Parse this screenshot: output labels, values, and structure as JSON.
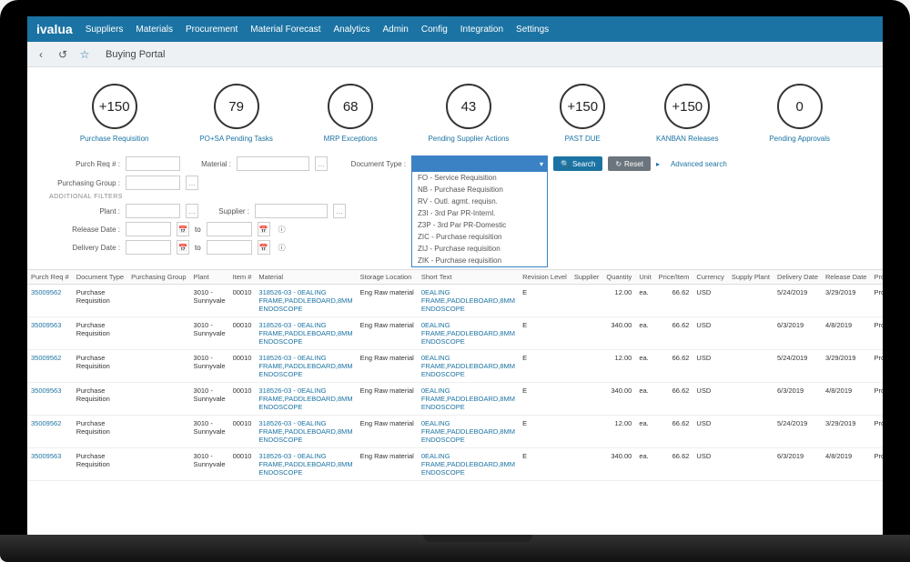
{
  "brand": "ivalua",
  "nav": [
    "Suppliers",
    "Materials",
    "Procurement",
    "Material Forecast",
    "Analytics",
    "Admin",
    "Config",
    "Integration",
    "Settings"
  ],
  "page_title": "Buying Portal",
  "kpis": [
    {
      "value": "+150",
      "label": "Purchase Requisition"
    },
    {
      "value": "79",
      "label": "PO+SA Pending Tasks"
    },
    {
      "value": "68",
      "label": "MRP Exceptions"
    },
    {
      "value": "43",
      "label": "Pending Supplier Actions"
    },
    {
      "value": "+150",
      "label": "PAST DUE"
    },
    {
      "value": "+150",
      "label": "KANBAN Releases"
    },
    {
      "value": "0",
      "label": "Pending Approvals"
    }
  ],
  "filters": {
    "purch_req_label": "Purch Req # :",
    "material_label": "Material :",
    "document_type_label": "Document Type :",
    "purchasing_group_label": "Purchasing Group :",
    "additional_filters_label": "ADDITIONAL FILTERS",
    "plant_label": "Plant :",
    "supplier_label": "Supplier :",
    "release_date_label": "Release Date :",
    "delivery_date_label": "Delivery Date :",
    "to_label": "to",
    "search_btn": "Search",
    "reset_btn": "Reset",
    "advanced_link": "Advanced search",
    "doc_type_options": [
      "FO - Service Requisition",
      "NB - Purchase Requisition",
      "RV - Outl. agmt. requisn.",
      "Z3I - 3rd Par PR-Internl.",
      "Z3P - 3rd Par PR-Domestic",
      "ZIC - Purchase requisition",
      "ZIJ - Purchase requisition",
      "ZIK - Purchase requisition"
    ]
  },
  "table": {
    "headers": [
      "Purch Req #",
      "Document Type",
      "Purchasing Group",
      "Plant",
      "Item #",
      "Material",
      "Storage Location",
      "Short Text",
      "Revision Level",
      "Supplier",
      "Quantity",
      "Unit",
      "Price/Item",
      "Currency",
      "Supply Plant",
      "Delivery Date",
      "Release Date",
      "Products types"
    ],
    "rows": [
      {
        "req": "35009562",
        "doc": "Purchase Requisition",
        "pg": "",
        "plant": "3010 - Sunnyvale",
        "item": "00010",
        "mat": "318526-03 - 0EALING FRAME,PADDLEBOARD,8MM ENDOSCOPE",
        "stor": "Eng Raw material",
        "short": "0EALING FRAME,PADDLEBOARD,8MM ENDOSCOPE",
        "rev": "E",
        "sup": "",
        "qty": "12.00",
        "unit": "ea.",
        "price": "66.62",
        "curr": "USD",
        "splant": "",
        "ddate": "5/24/2019",
        "rdate": "3/29/2019",
        "ptype": "Product"
      },
      {
        "req": "35009563",
        "doc": "Purchase Requisition",
        "pg": "",
        "plant": "3010 - Sunnyvale",
        "item": "00010",
        "mat": "318526-03 - 0EALING FRAME,PADDLEBOARD,8MM ENDOSCOPE",
        "stor": "Eng Raw material",
        "short": "0EALING FRAME,PADDLEBOARD,8MM ENDOSCOPE",
        "rev": "E",
        "sup": "",
        "qty": "340.00",
        "unit": "ea.",
        "price": "66.62",
        "curr": "USD",
        "splant": "",
        "ddate": "6/3/2019",
        "rdate": "4/8/2019",
        "ptype": "Product"
      },
      {
        "req": "35009562",
        "doc": "Purchase Requisition",
        "pg": "",
        "plant": "3010 - Sunnyvale",
        "item": "00010",
        "mat": "318526-03 - 0EALING FRAME,PADDLEBOARD,8MM ENDOSCOPE",
        "stor": "Eng Raw material",
        "short": "0EALING FRAME,PADDLEBOARD,8MM ENDOSCOPE",
        "rev": "E",
        "sup": "",
        "qty": "12.00",
        "unit": "ea.",
        "price": "66.62",
        "curr": "USD",
        "splant": "",
        "ddate": "5/24/2019",
        "rdate": "3/29/2019",
        "ptype": "Product"
      },
      {
        "req": "35009563",
        "doc": "Purchase Requisition",
        "pg": "",
        "plant": "3010 - Sunnyvale",
        "item": "00010",
        "mat": "318526-03 - 0EALING FRAME,PADDLEBOARD,8MM ENDOSCOPE",
        "stor": "Eng Raw material",
        "short": "0EALING FRAME,PADDLEBOARD,8MM ENDOSCOPE",
        "rev": "E",
        "sup": "",
        "qty": "340.00",
        "unit": "ea.",
        "price": "66.62",
        "curr": "USD",
        "splant": "",
        "ddate": "6/3/2019",
        "rdate": "4/8/2019",
        "ptype": "Product"
      },
      {
        "req": "35009562",
        "doc": "Purchase Requisition",
        "pg": "",
        "plant": "3010 - Sunnyvale",
        "item": "00010",
        "mat": "318526-03 - 0EALING FRAME,PADDLEBOARD,8MM ENDOSCOPE",
        "stor": "Eng Raw material",
        "short": "0EALING FRAME,PADDLEBOARD,8MM ENDOSCOPE",
        "rev": "E",
        "sup": "",
        "qty": "12.00",
        "unit": "ea.",
        "price": "66.62",
        "curr": "USD",
        "splant": "",
        "ddate": "5/24/2019",
        "rdate": "3/29/2019",
        "ptype": "Product"
      },
      {
        "req": "35009563",
        "doc": "Purchase Requisition",
        "pg": "",
        "plant": "3010 - Sunnyvale",
        "item": "00010",
        "mat": "318526-03 - 0EALING FRAME,PADDLEBOARD,8MM ENDOSCOPE",
        "stor": "Eng Raw material",
        "short": "0EALING FRAME,PADDLEBOARD,8MM ENDOSCOPE",
        "rev": "E",
        "sup": "",
        "qty": "340.00",
        "unit": "ea.",
        "price": "66.62",
        "curr": "USD",
        "splant": "",
        "ddate": "6/3/2019",
        "rdate": "4/8/2019",
        "ptype": "Product"
      }
    ]
  }
}
